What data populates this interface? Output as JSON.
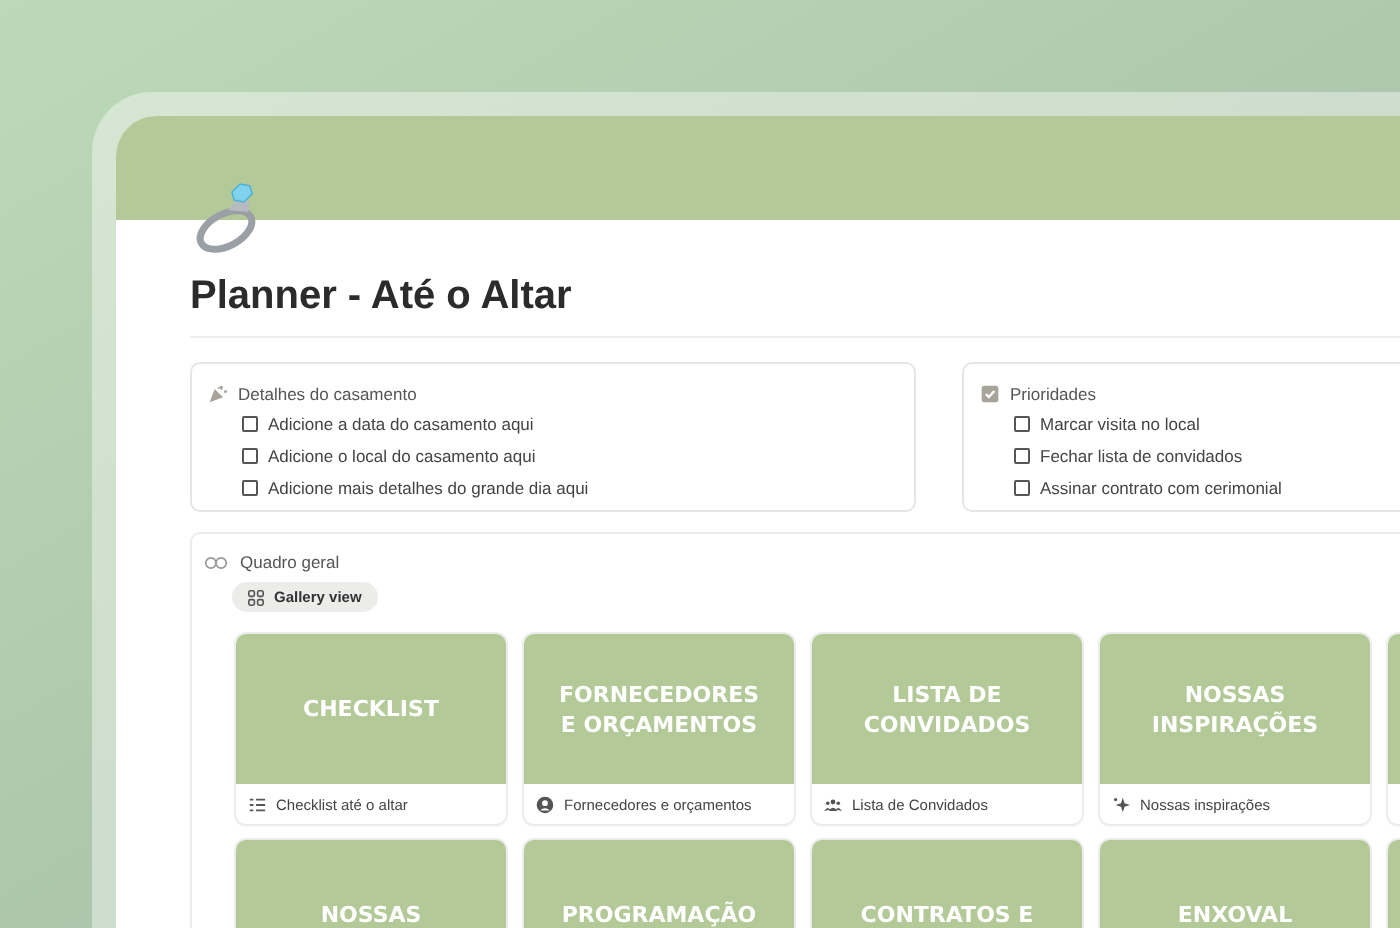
{
  "page": {
    "title": "Planner - Até o Altar"
  },
  "callouts": [
    {
      "kind": "party",
      "title": "Detalhes do casamento",
      "items": [
        {
          "label": "Adicione a data do casamento aqui",
          "checked": false
        },
        {
          "label": "Adicione o local do casamento aqui",
          "checked": false
        },
        {
          "label": "Adicione mais detalhes do grande dia aqui",
          "checked": false
        }
      ]
    },
    {
      "kind": "checkbox",
      "title": "Prioridades",
      "items": [
        {
          "label": "Marcar visita no local",
          "checked": false
        },
        {
          "label": "Fechar lista de convidados",
          "checked": false
        },
        {
          "label": "Assinar contrato com cerimonial",
          "checked": false
        }
      ]
    }
  ],
  "gallery": {
    "title": "Quadro geral",
    "view": {
      "label": "Gallery view",
      "selected": true
    },
    "cards": [
      {
        "kind": "checklist",
        "cover": "CHECKLIST",
        "caption": "Checklist até o altar"
      },
      {
        "kind": "contacts",
        "cover": "FORNECEDORES E ORÇAMENTOS",
        "caption": "Fornecedores e orçamentos"
      },
      {
        "kind": "guests",
        "cover": "LISTA DE CONVIDADOS",
        "caption": "Lista de Convidados"
      },
      {
        "kind": "inspiration",
        "cover": "NOSSAS INSPIRAÇÕES",
        "caption": "Nossas inspirações"
      },
      {
        "kind": "cover_only"
      },
      {
        "kind": "cover_only",
        "cover": "NOSSAS"
      },
      {
        "kind": "cover_only",
        "cover": "PROGRAMAÇÃO"
      },
      {
        "kind": "cover_only",
        "cover": "CONTRATOS E"
      },
      {
        "kind": "cover_only",
        "cover": "ENXOVAL"
      },
      {
        "kind": "cover_only"
      }
    ]
  }
}
